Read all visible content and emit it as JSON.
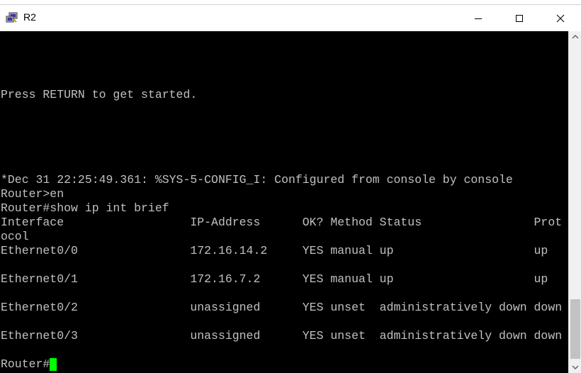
{
  "window": {
    "title": "R2",
    "icon": "putty-app-icon",
    "controls": [
      "minimize-icon",
      "maximize-icon",
      "close-icon"
    ]
  },
  "terminal": {
    "lines": [
      "",
      "",
      "",
      "",
      "Press RETURN to get started.",
      "",
      "",
      "",
      "",
      "",
      "*Dec 31 22:25:49.361: %SYS-5-CONFIG_I: Configured from console by console",
      "Router>en",
      "Router#show ip int brief",
      "Interface                  IP-Address      OK? Method Status                Prot",
      "ocol",
      "Ethernet0/0                172.16.14.2     YES manual up                    up",
      "",
      "Ethernet0/1                172.16.7.2      YES manual up                    up",
      "",
      "Ethernet0/2                unassigned      YES unset  administratively down down",
      "",
      "Ethernet0/3                unassigned      YES unset  administratively down down",
      "",
      "Router#"
    ],
    "text_color": "#c0c0c0",
    "background": "#000000",
    "cursor_color": "#00ff00"
  }
}
